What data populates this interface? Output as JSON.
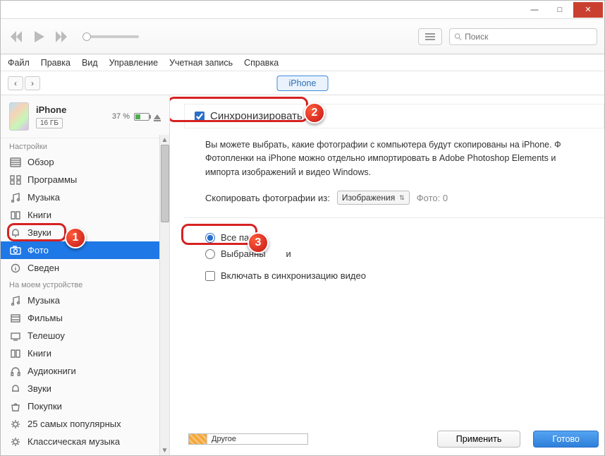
{
  "window": {
    "minimize": "—",
    "maximize": "□",
    "close": "✕"
  },
  "toolbar": {
    "search_placeholder": "Поиск"
  },
  "menu": {
    "file": "Файл",
    "edit": "Правка",
    "view": "Вид",
    "controls": "Управление",
    "account": "Учетная запись",
    "help": "Справка"
  },
  "nav": {
    "device": "iPhone"
  },
  "device": {
    "name": "iPhone",
    "capacity": "16 ГБ",
    "battery_pct": "37 %"
  },
  "sidebar": {
    "settings_label": "Настройки",
    "on_device_label": "На моем устройстве",
    "items_settings": [
      {
        "label": "Обзор"
      },
      {
        "label": "Программы"
      },
      {
        "label": "Музыка"
      },
      {
        "label": "Книги"
      },
      {
        "label": "Звуки"
      },
      {
        "label": "Фото"
      },
      {
        "label": "Сведен"
      }
    ],
    "items_device": [
      {
        "label": "Музыка"
      },
      {
        "label": "Фильмы"
      },
      {
        "label": "Телешоу"
      },
      {
        "label": "Книги"
      },
      {
        "label": "Аудиокниги"
      },
      {
        "label": "Звуки"
      },
      {
        "label": "Покупки"
      },
      {
        "label": "25 самых популярных"
      },
      {
        "label": "Классическая музыка"
      }
    ]
  },
  "content": {
    "sync_label": "Синхронизировать",
    "help_line1": "Вы можете выбрать, какие фотографии с компьютера будут скопированы на iPhone. Ф",
    "help_line2": "Фотопленки на iPhone можно отдельно импортировать в Adobe Photoshop Elements и",
    "help_line3": "импорта изображений и видео Windows.",
    "copy_from_label": "Скопировать фотографии из:",
    "source_select": "Изображения",
    "photo_count": "Фото: 0",
    "radio_all": "Все папки",
    "radio_selected": "Выбранны",
    "radio_selected_suffix": "и",
    "include_video": "Включать в синхронизацию видео"
  },
  "bottom": {
    "storage_other": "Другое",
    "apply": "Применить",
    "done": "Готово"
  },
  "annotations": {
    "b1": "1",
    "b2": "2",
    "b3": "3"
  }
}
